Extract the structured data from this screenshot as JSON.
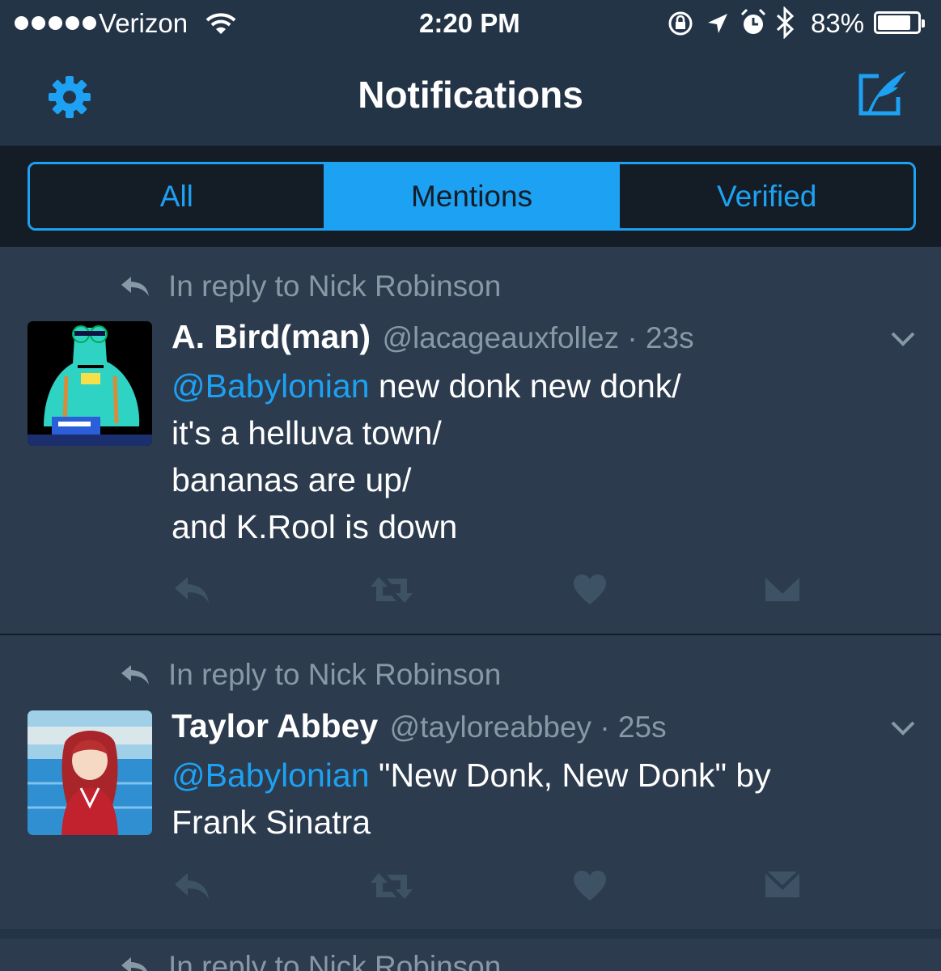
{
  "status_bar": {
    "carrier": "Verizon",
    "time": "2:20 PM",
    "battery": "83%",
    "icons": [
      "signal-dots-icon",
      "wifi-icon",
      "rotation-lock-icon",
      "location-arrow-icon",
      "alarm-icon",
      "bluetooth-icon",
      "battery-icon"
    ]
  },
  "nav": {
    "title": "Notifications",
    "left_icon": "gear-icon",
    "right_icon": "compose-tweet-icon"
  },
  "tabs": [
    {
      "label": "All",
      "active": false
    },
    {
      "label": "Mentions",
      "active": true
    },
    {
      "label": "Verified",
      "active": false
    }
  ],
  "tweets": [
    {
      "context": "In reply to Nick Robinson",
      "name": "A. Bird(man)",
      "handle": "@lacageauxfollez · 23s",
      "mention": "@Babylonian",
      "text": " new donk new donk/\nit's a helluva town/\nbananas are up/\nand K.Rool is down",
      "avatar": "cartoon-alien-avatar"
    },
    {
      "context": "In reply to Nick Robinson",
      "name": "Taylor Abbey",
      "handle": "@tayloreabbey · 25s",
      "mention": "@Babylonian",
      "text": " \"New Donk, New Donk\" by\nFrank Sinatra",
      "avatar": "anime-girl-avatar"
    },
    {
      "context": "In reply to Nick Robinson"
    }
  ],
  "colors": {
    "accent": "#1da1f2",
    "background": "#243447",
    "card": "#2c3b4e",
    "muted": "#8899a6",
    "dark": "#141d26"
  }
}
